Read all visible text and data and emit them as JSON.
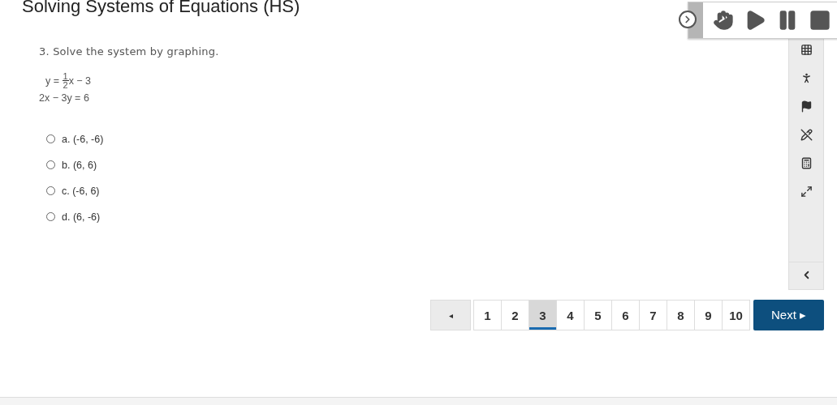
{
  "title": "Solving Systems of Equations (HS)",
  "question": {
    "prompt": "3. Solve the system by graphing.",
    "equations": [
      {
        "kind": "fraction",
        "before": "y = ",
        "numerator": "1",
        "denominator": "2",
        "after": "x − 3"
      },
      {
        "kind": "plain",
        "text": "2x − 3y = 6"
      }
    ],
    "options": [
      {
        "label": "a. (-6, -6)",
        "selected": false
      },
      {
        "label": "b. (6, 6)",
        "selected": false
      },
      {
        "label": "c. (-6, 6)",
        "selected": false
      },
      {
        "label": "d. (6, -6)",
        "selected": false
      }
    ]
  },
  "pagination": {
    "previous": "◂",
    "pages": [
      {
        "label": "1",
        "selected": false
      },
      {
        "label": "2",
        "selected": false
      },
      {
        "label": "3",
        "selected": true
      },
      {
        "label": "4",
        "selected": false
      },
      {
        "label": "5",
        "selected": false
      },
      {
        "label": "6",
        "selected": false
      },
      {
        "label": "7",
        "selected": false
      },
      {
        "label": "8",
        "selected": false
      },
      {
        "label": "9",
        "selected": false
      },
      {
        "label": "10",
        "selected": false
      }
    ],
    "next": "Next ▸"
  }
}
